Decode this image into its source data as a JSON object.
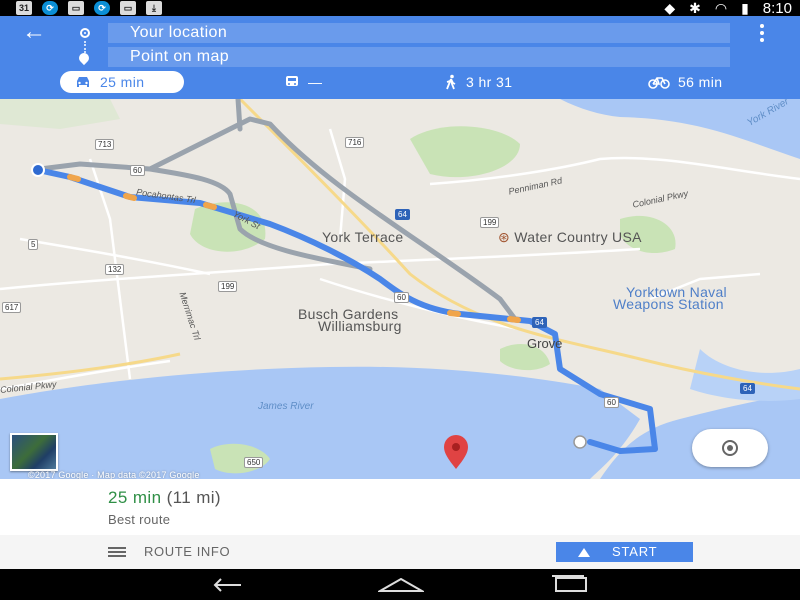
{
  "status_bar": {
    "left_icons": [
      "calendar-icon",
      "sync-icon",
      "app-icon",
      "sync-icon",
      "app-icon",
      "download-icon"
    ],
    "calendar_day": "31",
    "time": "8:10"
  },
  "header": {
    "origin": "Your location",
    "destination": "Point on map",
    "modes": [
      {
        "mode": "drive",
        "label": "25 min",
        "active": true
      },
      {
        "mode": "transit",
        "label": "—",
        "active": false
      },
      {
        "mode": "walk",
        "label": "3 hr 31",
        "active": false
      },
      {
        "mode": "bike",
        "label": "56 min",
        "active": false
      }
    ]
  },
  "map": {
    "labels": {
      "york_terrace": "York Terrace",
      "water_country": "Water Country USA",
      "yorktown_1": "Yorktown Naval",
      "yorktown_2": "Weapons Station",
      "busch_1": "Busch Gardens",
      "busch_2": "Williamsburg",
      "grove": "Grove",
      "james_river": "James River",
      "york_river": "York River",
      "colonial_pkwy_left": "Colonial Pkwy",
      "colonial_pkwy_right": "Colonial Pkwy",
      "pocahontas": "Pocahontas Trl",
      "penniman": "Penniman Rd",
      "york_st": "York St",
      "merrimac": "Merrimac Trl"
    },
    "shields": {
      "s716": "716",
      "s713": "713",
      "s60a": "60",
      "s64a": "64",
      "s199a": "199",
      "s5": "5",
      "s132": "132",
      "s199b": "199",
      "s60b": "60",
      "s617": "617",
      "s64b": "64",
      "s60c": "60",
      "s64c": "64",
      "s650": "650"
    },
    "copyright": "©2017 Google · Map data ©2017 Google",
    "route_color": "#4a86e8",
    "alt_route_color": "#9aa3ad"
  },
  "summary": {
    "duration": "25 min",
    "distance": "(11 mi)",
    "note": "Best route"
  },
  "actions": {
    "route_info": "ROUTE INFO",
    "start": "START"
  },
  "colors": {
    "header": "#4a86e8",
    "eta_green": "#2f8f46",
    "water": "#a9c7f5",
    "park": "#c9e3b6"
  }
}
